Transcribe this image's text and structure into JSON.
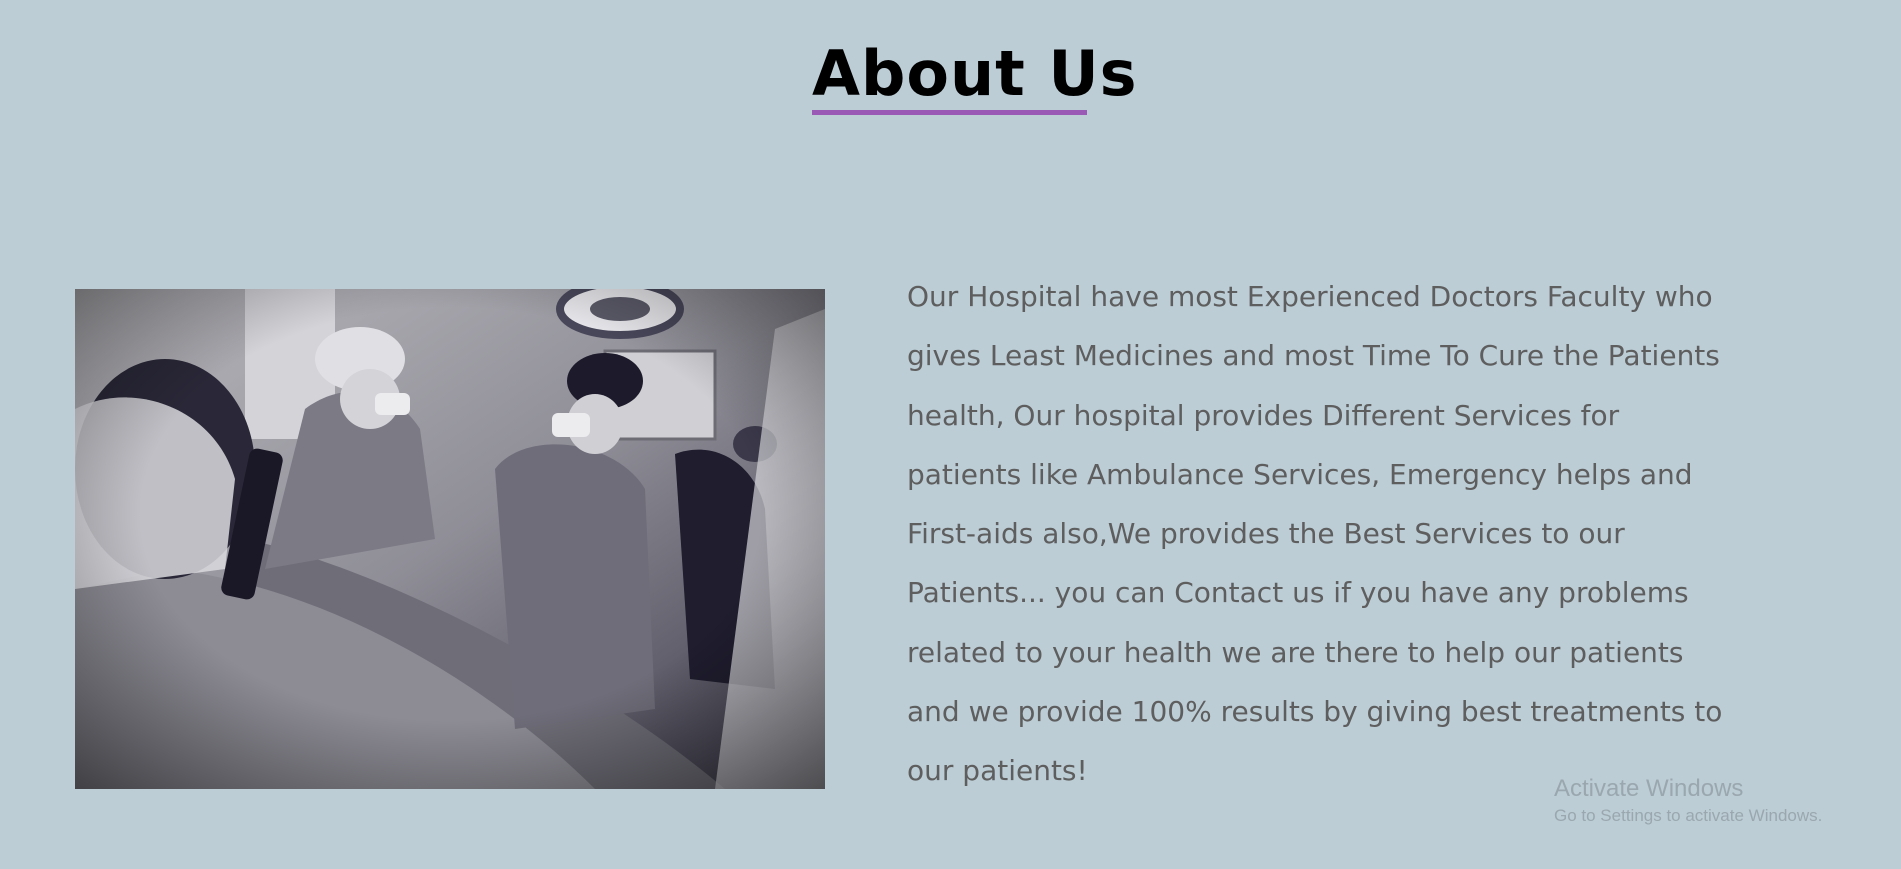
{
  "about": {
    "title": "About Us",
    "paragraph": "Our Hospital have most Experienced Doctors Faculty who gives Least Medicines and most Time To Cure the Patients health, Our hospital provides Different Services for patients like Ambulance Services, Emergency helps and First-aids also,We provides the Best Services to our Patients... you can Contact us if you have any problems related to your health we are there to help our patients and we provide 100% results by giving best treatments to our patients!"
  },
  "watermark": {
    "title": "Activate Windows",
    "subtitle": "Go to Settings to activate Windows."
  },
  "colors": {
    "background": "#bccdd6",
    "accent": "#9b59b6",
    "text": "#5e5e5e"
  }
}
